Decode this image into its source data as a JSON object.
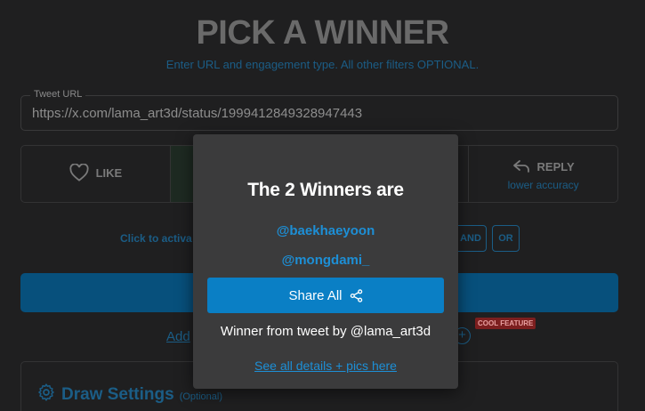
{
  "header": {
    "title": "PICK A WINNER",
    "subtitle": "Enter URL and engagement type. All other filters OPTIONAL."
  },
  "url_field": {
    "label": "Tweet URL",
    "value": "https://x.com/lama_art3d/status/1999412849328947443"
  },
  "engagement": {
    "like_label": "LIKE",
    "reply_label": "REPLY",
    "reply_sub": "lower accuracy"
  },
  "filters": {
    "activate_text": "Click to activa",
    "and_label": "AND",
    "or_label": "OR"
  },
  "add_link": "Add",
  "cool_badge": "COOL FEATURE",
  "draw_settings": {
    "title": "Draw Settings",
    "optional": "(Optional)"
  },
  "modal": {
    "title": "The 2 Winners are",
    "winners": [
      "@baekhaeyoon",
      "@mongdami_"
    ],
    "share_label": "Share All",
    "winner_from": "Winner from tweet by @lama_art3d",
    "details_link": "See all details + pics here"
  },
  "colors": {
    "background": "#1f1f20",
    "accent_blue": "#1d8fd6",
    "share_button": "#0a7fc5",
    "modal_bg": "#3b3b3c",
    "badge_red": "#7c1f1f"
  },
  "icons": {
    "like": "heart-icon",
    "reply": "reply-arrow-icon",
    "share": "share-icon",
    "settings": "gear-icon",
    "add": "plus-circle-icon"
  }
}
